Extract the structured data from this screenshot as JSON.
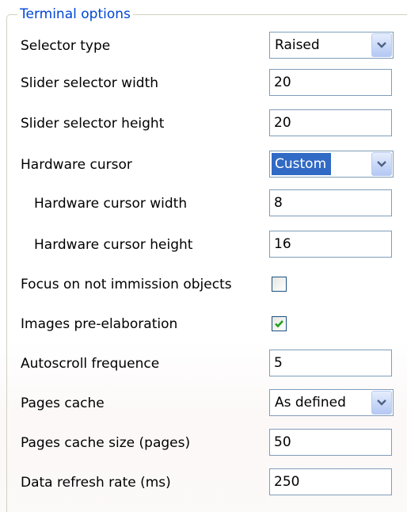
{
  "group": {
    "title": "Terminal options"
  },
  "selector_type": {
    "label": "Selector type",
    "value": "Raised"
  },
  "slider_selector_width": {
    "label": "Slider selector width",
    "value": "20"
  },
  "slider_selector_height": {
    "label": "Slider selector height",
    "value": "20"
  },
  "hardware_cursor": {
    "label": "Hardware cursor",
    "value": "Custom"
  },
  "hardware_cursor_width": {
    "label": "Hardware cursor width",
    "value": "8"
  },
  "hardware_cursor_height": {
    "label": "Hardware cursor height",
    "value": "16"
  },
  "focus_on_not_immission": {
    "label": "Focus on not immission objects",
    "checked": false
  },
  "images_pre_elaboration": {
    "label": "Images pre-elaboration",
    "checked": true
  },
  "autoscroll_frequence": {
    "label": "Autoscroll frequence",
    "value": "5"
  },
  "pages_cache": {
    "label": "Pages cache",
    "value": "As defined"
  },
  "pages_cache_size": {
    "label": "Pages cache size (pages)",
    "value": "50"
  },
  "data_refresh_rate": {
    "label": "Data refresh rate (ms)",
    "value": "250"
  },
  "icons": {
    "dropdown": "chevron-down-icon",
    "check": "checkmark-icon"
  },
  "colors": {
    "legend_text": "#0046d5",
    "field_border": "#7f9db9",
    "selection": "#316ac5",
    "check_mark": "#21a121"
  }
}
